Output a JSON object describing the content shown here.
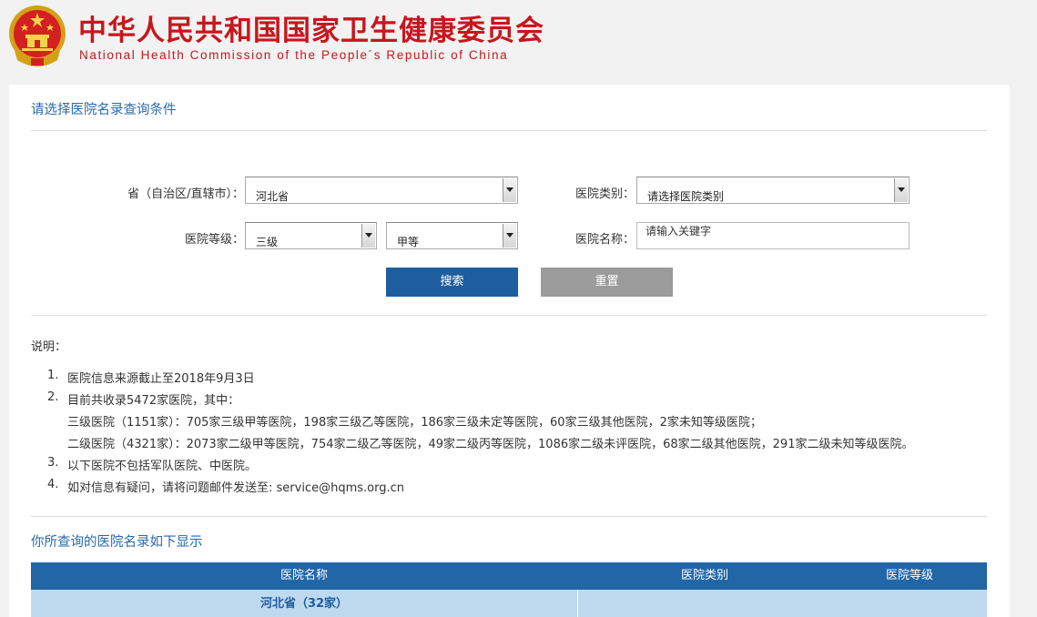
{
  "header": {
    "title_cn": "中华人民共和国国家卫生健康委员会",
    "title_en": "National Health Commission of the People´s Republic of China",
    "emblem_icon": "national-emblem-icon",
    "brand_color": "#c8161d"
  },
  "search": {
    "section_title": "请选择医院名录查询条件",
    "province_label": "省（自治区/直辖市）：",
    "province_value": "河北省",
    "category_label": "医院类别：",
    "category_value": "请选择医院类别",
    "level_label": "医院等级：",
    "level_value": "三级",
    "grade_value": "甲等",
    "name_label": "医院名称：",
    "name_placeholder": "请输入关键字",
    "search_button": "搜索",
    "reset_button": "重置",
    "accent_color": "#1f5e9e"
  },
  "notes": {
    "title": "说明：",
    "items": [
      {
        "num": "1.",
        "text": "医院信息来源截止至2018年9月3日"
      },
      {
        "num": "2.",
        "text": "目前共收录5472家医院，其中："
      },
      {
        "num": "",
        "text": "三级医院（1151家）：705家三级甲等医院，198家三级乙等医院，186家三级未定等医院，60家三级其他医院，2家未知等级医院；"
      },
      {
        "num": "",
        "text": "二级医院（4321家）：2073家二级甲等医院，754家二级乙等医院，49家二级丙等医院，1086家二级未评医院，68家二级其他医院，291家二级未知等级医院。"
      },
      {
        "num": "3.",
        "text": "以下医院不包括军队医院、中医院。"
      },
      {
        "num": "4.",
        "text": "如对信息有疑问，请将问题邮件发送至: service@hqms.org.cn"
      }
    ]
  },
  "results": {
    "section_title": "你所查询的医院名录如下显示",
    "columns": [
      "医院名称",
      "医院类别",
      "医院等级"
    ],
    "groups": [
      {
        "name": "河北省（32家）",
        "category": "",
        "level": ""
      }
    ]
  }
}
